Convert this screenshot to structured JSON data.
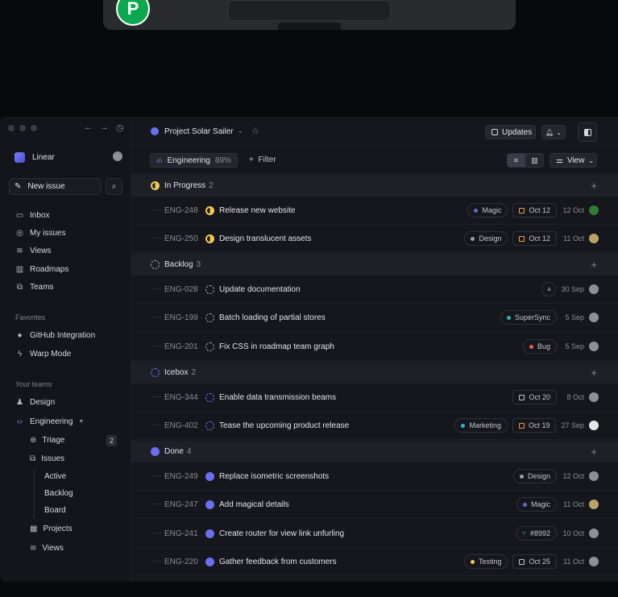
{
  "top_window": {
    "logo_letter": "P"
  },
  "sidebar": {
    "workspace": "Linear",
    "new_issue": "New issue",
    "nav": [
      {
        "label": "Inbox",
        "icon": "inbox-icon"
      },
      {
        "label": "My issues",
        "icon": "my-issues-icon"
      },
      {
        "label": "Views",
        "icon": "views-icon"
      },
      {
        "label": "Roadmaps",
        "icon": "roadmaps-icon"
      },
      {
        "label": "Teams",
        "icon": "teams-icon"
      }
    ],
    "favorites_title": "Favorites",
    "favorites": [
      {
        "label": "GitHub Integration",
        "icon": "github-icon"
      },
      {
        "label": "Warp Mode",
        "icon": "bolt-icon"
      }
    ],
    "your_teams_title": "Your teams",
    "teams": [
      {
        "label": "Design",
        "icon": "design-icon"
      },
      {
        "label": "Engineering",
        "icon": "code-icon"
      }
    ],
    "engineering_items": [
      {
        "label": "Triage",
        "badge": "2"
      },
      {
        "label": "Issues"
      },
      {
        "label": "Projects"
      },
      {
        "label": "Views"
      }
    ],
    "issues_sub": [
      "Active",
      "Backlog",
      "Board"
    ]
  },
  "header": {
    "project": "Project Solar Sailer",
    "updates": "Updates"
  },
  "filterbar": {
    "team": "Engineering",
    "team_pct": "89%",
    "filter": "Filter",
    "view": "View"
  },
  "groups": [
    {
      "label": "In Progress",
      "count": "2"
    },
    {
      "label": "Backlog",
      "count": "3"
    },
    {
      "label": "Icebox",
      "count": "2"
    },
    {
      "label": "Done",
      "count": "4"
    }
  ],
  "rows": [
    {
      "id": "ENG-248",
      "title": "Release new website",
      "label": "Magic",
      "label_color": "#5e6ad2",
      "due": "Oct 12",
      "date": "12 Oct"
    },
    {
      "id": "ENG-250",
      "title": "Design translucent assets",
      "label": "Design",
      "label_color": "#9aa0a8",
      "due": "Oct 12",
      "date": "11 Oct"
    },
    {
      "id": "ENG-028",
      "title": "Update documentation",
      "date": "30 Sep"
    },
    {
      "id": "ENG-199",
      "title": "Batch loading of partial stores",
      "label": "SuperSync",
      "label_color": "#26b5a8",
      "date": "5 Sep"
    },
    {
      "id": "ENG-201",
      "title": "Fix CSS in roadmap team graph",
      "label": "Bug",
      "label_color": "#eb5757",
      "date": "5 Sep"
    },
    {
      "id": "ENG-344",
      "title": "Enable data transmission beams",
      "due": "Oct 20",
      "date": "8 Oct"
    },
    {
      "id": "ENG-402",
      "title": "Tease the upcoming product release",
      "label": "Marketing",
      "label_color": "#26b5ce",
      "due": "Oct 19",
      "date": "27 Sep"
    },
    {
      "id": "ENG-249",
      "title": "Replace isometric screenshots",
      "label": "Design",
      "label_color": "#9aa0a8",
      "date": "12 Oct"
    },
    {
      "id": "ENG-247",
      "title": "Add magical details",
      "label": "Magic",
      "label_color": "#5e6ad2",
      "date": "11 Oct"
    },
    {
      "id": "ENG-241",
      "title": "Create router for view link unfurling",
      "label": "#8992",
      "date": "10 Oct"
    },
    {
      "id": "ENG-220",
      "title": "Gather feedback from customers",
      "label": "Testing",
      "label_color": "#f2c94c",
      "due": "Oct 25",
      "date": "11 Oct"
    }
  ],
  "colors": {
    "accent": "#6a6ff0",
    "in_progress": "#f2c94c",
    "due_warn": "#f2994a"
  }
}
